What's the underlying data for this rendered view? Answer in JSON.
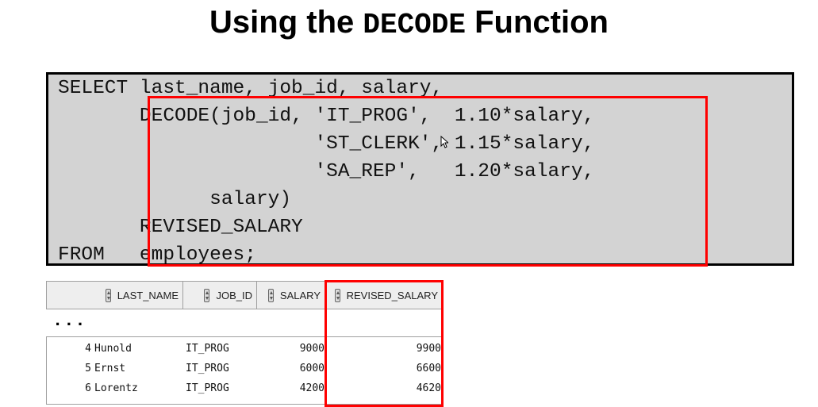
{
  "slide": {
    "title_part1": "Using the",
    "title_code": "DECODE",
    "title_part2": "Function"
  },
  "code": {
    "lines": [
      "SELECT last_name, job_id, salary,",
      "       DECODE(job_id, 'IT_PROG',  1.10*salary,",
      "                      'ST_CLERK', 1.15*salary,",
      "                      'SA_REP',   1.20*salary,",
      "             salary)",
      "       REVISED_SALARY",
      "FROM   employees;"
    ]
  },
  "results": {
    "columns": [
      "LAST_NAME",
      "JOB_ID",
      "SALARY",
      "REVISED_SALARY"
    ],
    "ellipsis": "...",
    "rows": [
      {
        "num": "4",
        "last_name": "Hunold",
        "job_id": "IT_PROG",
        "salary": "9000",
        "revised": "9900"
      },
      {
        "num": "5",
        "last_name": "Ernst",
        "job_id": "IT_PROG",
        "salary": "6000",
        "revised": "6600"
      },
      {
        "num": "6",
        "last_name": "Lorentz",
        "job_id": "IT_PROG",
        "salary": "4200",
        "revised": "4620"
      }
    ]
  },
  "colors": {
    "highlight": "#ff0000",
    "code_background": "#d3d3d3"
  }
}
